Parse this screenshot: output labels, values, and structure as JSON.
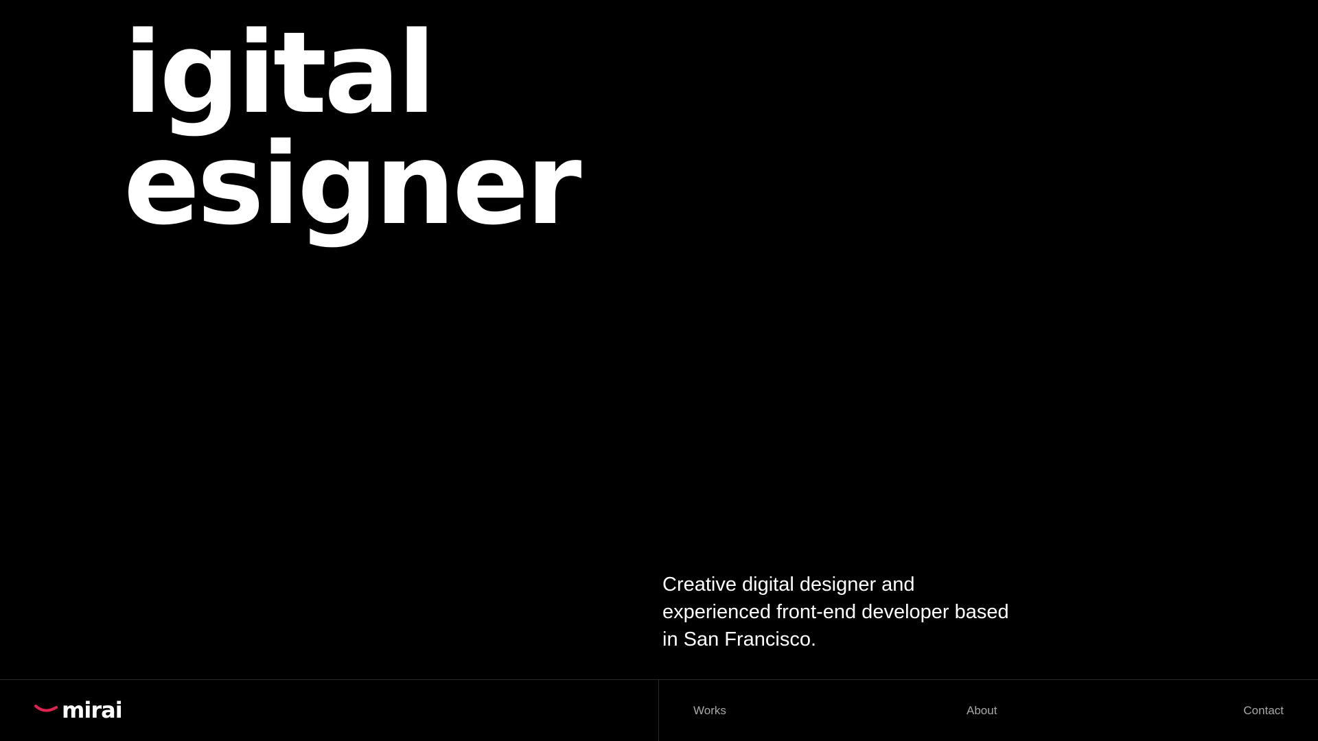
{
  "hero": {
    "line1": "igital",
    "line2": "esigner"
  },
  "tagline": {
    "line1": "Creative digital designer and",
    "line2": "experienced front-end developer based",
    "line3": "in San Francisco."
  },
  "footer": {
    "logo": {
      "text": "mirai",
      "icon": "smile-arc-icon",
      "accent_color": "#e0234e"
    },
    "nav": {
      "works": "Works",
      "about": "About",
      "contact": "Contact"
    }
  },
  "colors": {
    "background": "#000000",
    "text": "#ffffff",
    "nav_text": "#a8a8a8",
    "divider": "#2a2a2a"
  }
}
